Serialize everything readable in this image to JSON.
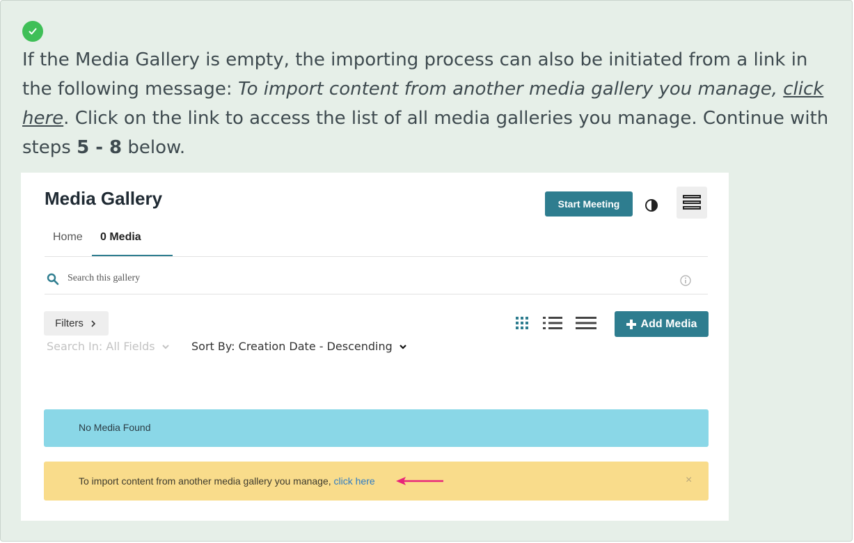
{
  "note": {
    "p1": "If the Media Gallery is empty, the importing process can also be initiated from a link in the following message: ",
    "italic": "To import content from another media gallery you manage, ",
    "italic_link": "click here",
    "p2": ". Click on the link to access the list of all media galleries you manage. Continue with steps ",
    "steps": "5 - 8",
    "p3": " below."
  },
  "gallery": {
    "title": "Media Gallery",
    "start_meeting": "Start Meeting",
    "tabs": [
      {
        "label": "Home",
        "active": false
      },
      {
        "label": "0 Media",
        "active": true
      }
    ],
    "search_placeholder": "Search this gallery",
    "filters_label": "Filters",
    "add_media_label": "Add Media",
    "search_in": "Search In: All Fields",
    "sort_by": "Sort By: Creation Date - Descending",
    "no_media": "No Media Found",
    "import_text": "To import content from another media gallery you manage, ",
    "import_link": "click here",
    "close": "×"
  },
  "colors": {
    "callout_bg": "#e6efe8",
    "accent": "#2e7d8f",
    "info_bar": "#8ad7e7",
    "warning_bar": "#f9dc8b",
    "arrow": "#e8237a",
    "check": "#3fbf57"
  }
}
